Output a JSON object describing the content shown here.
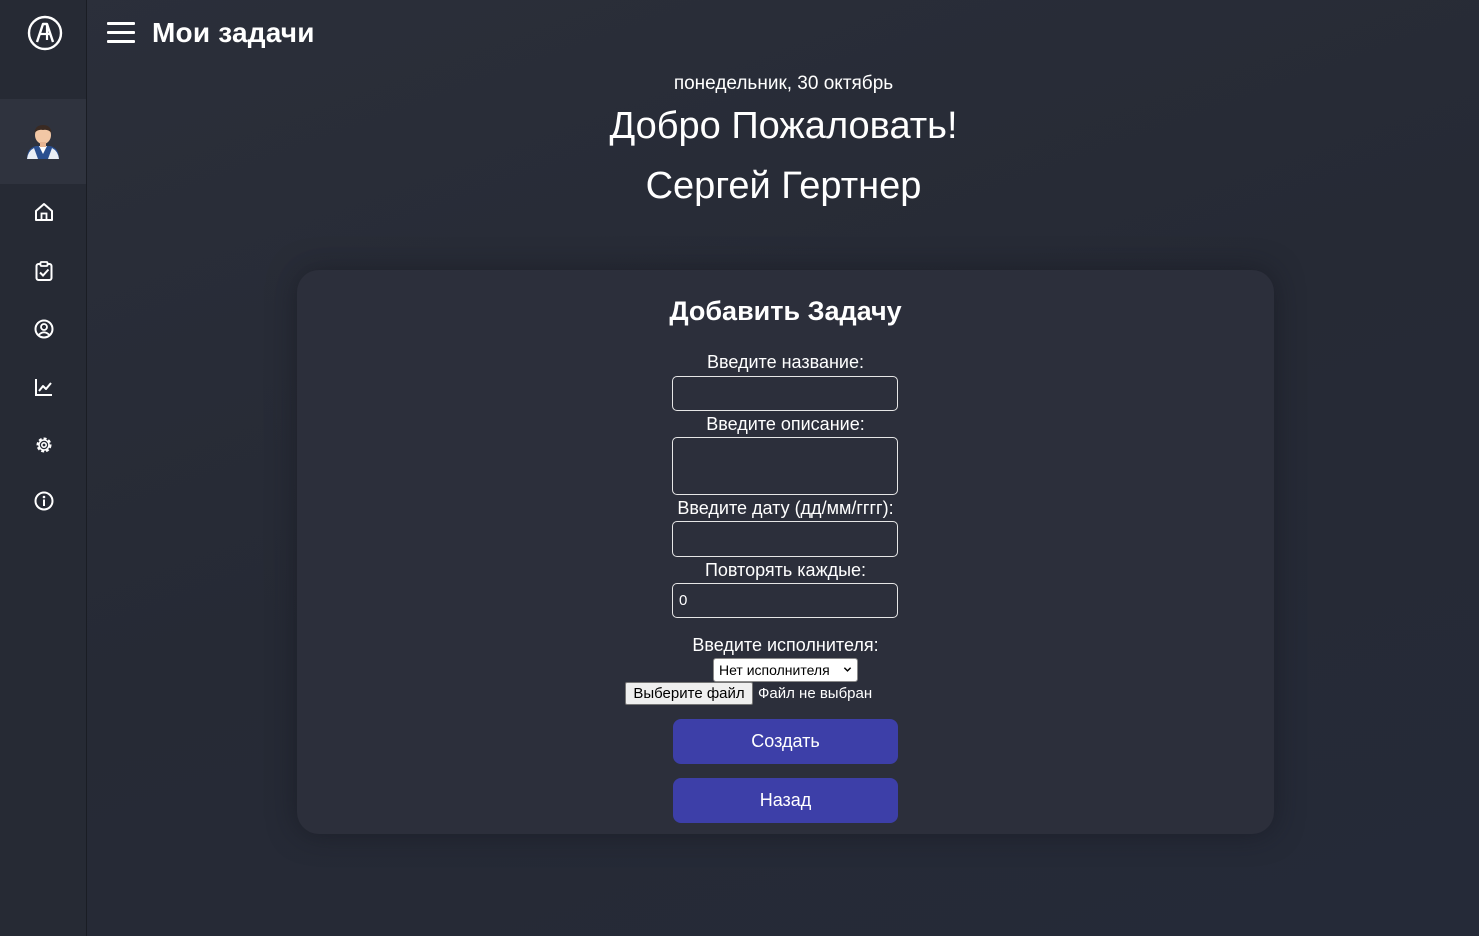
{
  "app": {
    "logo_icon": "brand-logo-icon",
    "brand_color": "#3d3fa8"
  },
  "sidebar": {
    "avatar_icon": "user-avatar-icon",
    "items": [
      {
        "name": "home",
        "icon": "home-icon"
      },
      {
        "name": "tasks",
        "icon": "clipboard-check-icon"
      },
      {
        "name": "profile",
        "icon": "user-circle-icon"
      },
      {
        "name": "analytics",
        "icon": "chart-line-icon"
      },
      {
        "name": "settings",
        "icon": "gear-icon"
      },
      {
        "name": "info",
        "icon": "info-icon"
      }
    ]
  },
  "header": {
    "menu_icon": "hamburger-menu-icon",
    "title": "Мои задачи"
  },
  "greeting": {
    "date": "понедельник, 30 октябрь",
    "welcome": "Добро Пожаловать!",
    "user_name": "Сергей Гертнер"
  },
  "form": {
    "title": "Добавить Задачу",
    "name_label": "Введите название:",
    "name_value": "",
    "description_label": "Введите описание:",
    "description_value": "",
    "date_label": "Введите дату (дд/мм/гггг):",
    "date_value": "",
    "repeat_label": "Повторять каждые:",
    "repeat_value": "0",
    "assignee_label": "Введите исполнителя:",
    "assignee_selected": "Нет исполнителя",
    "file_button_label": "Выберите файл",
    "file_status": "Файл не выбран",
    "create_button": "Создать",
    "back_button": "Назад"
  }
}
